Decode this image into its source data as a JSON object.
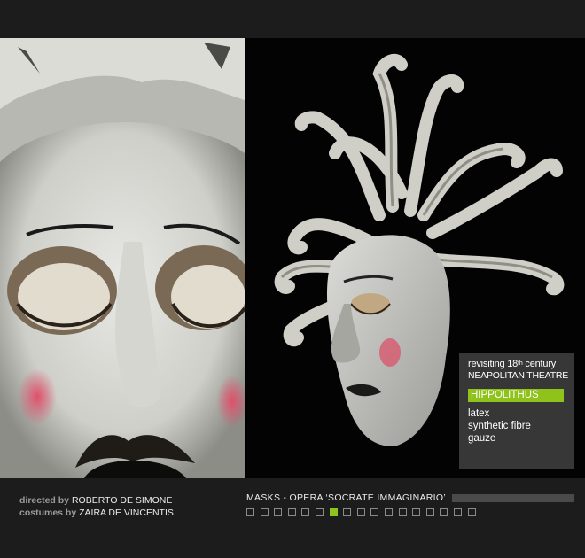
{
  "info": {
    "line1_prefix": "revisiting 18",
    "line1_sup": "th",
    "line1_suffix": " century",
    "line2": "NEAPOLITAN THEATRE",
    "character": "HIPPOLITHUS",
    "materials": [
      "latex",
      "synthetic fibre",
      "gauze"
    ]
  },
  "credits": {
    "director_label": "directed by",
    "director_name": "ROBERTO DE SIMONE",
    "costumes_label": "costumes by",
    "costumes_name": "ZAIRA DE VINCENTIS"
  },
  "caption": "MASKS  -  OPERA ‘SOCRATE IMMAGINARIO’",
  "pager": {
    "total": 17,
    "active_index": 6
  },
  "colors": {
    "accent": "#8fc21a",
    "background": "#1c1c1c"
  }
}
